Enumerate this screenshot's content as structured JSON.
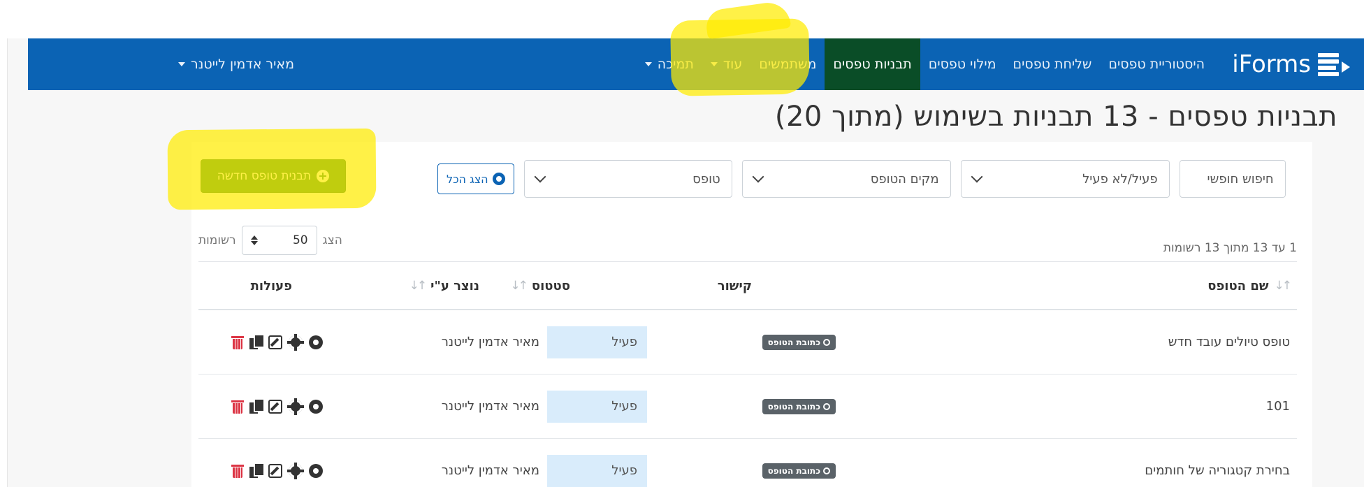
{
  "brand": {
    "name": "iForms"
  },
  "nav": {
    "items": [
      {
        "label": "היסטוריית טפסים",
        "active": false,
        "dropdown": false
      },
      {
        "label": "שליחת טפסים",
        "active": false,
        "dropdown": false
      },
      {
        "label": "מילוי טפסים",
        "active": false,
        "dropdown": false
      },
      {
        "label": "תבניות טפסים",
        "active": true,
        "dropdown": false
      },
      {
        "label": "משתמשים",
        "active": false,
        "dropdown": false
      },
      {
        "label": "עוד",
        "active": false,
        "dropdown": true
      },
      {
        "label": "תמיכה",
        "active": false,
        "dropdown": true
      }
    ],
    "user": "מאיר אדמין לייטנר"
  },
  "page": {
    "title": "תבניות טפסים - 13 תבניות בשימוש (מתוך 20)"
  },
  "filters": {
    "free_search_placeholder": "חיפוש חופשי",
    "status_select": "פעיל/לא פעיל",
    "location_select": "מקים הטופס",
    "form_select": "טופס",
    "show_all_label": "הצג הכל"
  },
  "toolbar": {
    "new_template_label": "תבנית טופס חדשה"
  },
  "length": {
    "prefix": "הצג",
    "value": "50",
    "suffix": "רשומות"
  },
  "table": {
    "info": "1 עד 13 מתוך 13 רשומות",
    "headers": {
      "name": "שם הטופס",
      "link": "קישור",
      "status": "סטטוס",
      "created_by": "נוצר ע\"י",
      "actions": "פעולות"
    },
    "link_badge_label": "כתובת הטופס",
    "rows": [
      {
        "name": "טופס טיולים עובד חדש",
        "status": "פעיל",
        "created_by": "מאיר אדמין לייטנר"
      },
      {
        "name": "101",
        "status": "פעיל",
        "created_by": "מאיר אדמין לייטנר"
      },
      {
        "name": "בחירת קטגוריה של חותמים",
        "status": "פעיל",
        "created_by": "מאיר אדמין לייטנר"
      }
    ]
  },
  "colors": {
    "navbar": "#0b63b4",
    "active_nav": "#0a4d27",
    "primary_button": "#1e7e34",
    "highlight": "#ffeb00",
    "status_bg": "#d9ecfb",
    "delete_icon": "#dc3545"
  },
  "icons": {
    "row_actions": [
      "eye-icon",
      "gear-icon",
      "edit-icon",
      "copy-icon",
      "trash-icon"
    ]
  }
}
